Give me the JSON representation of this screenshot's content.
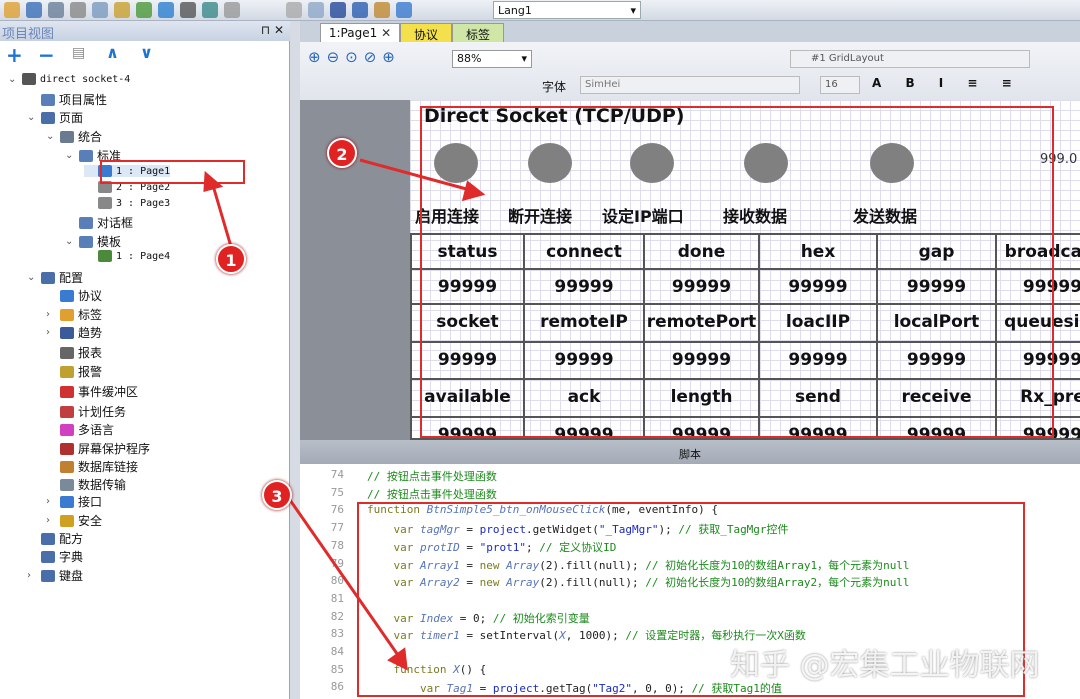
{
  "toolbar": {
    "language": "Lang1"
  },
  "project_view": {
    "title": "项目视图",
    "tree": [
      {
        "label": "direct socket-4",
        "level": 0,
        "mono": true
      },
      {
        "label": "项目属性",
        "level": 1
      },
      {
        "label": "页面",
        "level": 1
      },
      {
        "label": "统合",
        "level": 2
      },
      {
        "label": "标准",
        "level": 3
      },
      {
        "label": "1 : Page1",
        "level": 4,
        "mono": true,
        "selected": true
      },
      {
        "label": "2 : Page2",
        "level": 4,
        "mono": true
      },
      {
        "label": "3 : Page3",
        "level": 4,
        "mono": true
      },
      {
        "label": "对话框",
        "level": 3
      },
      {
        "label": "模板",
        "level": 3
      },
      {
        "label": "1 : Page4",
        "level": 4,
        "mono": true
      },
      {
        "label": "配置",
        "level": 1
      },
      {
        "label": "协议",
        "level": 2
      },
      {
        "label": "标签",
        "level": 2
      },
      {
        "label": "趋势",
        "level": 2
      },
      {
        "label": "报表",
        "level": 2
      },
      {
        "label": "报警",
        "level": 2
      },
      {
        "label": "事件缓冲区",
        "level": 2
      },
      {
        "label": "计划任务",
        "level": 2
      },
      {
        "label": "多语言",
        "level": 2
      },
      {
        "label": "屏幕保护程序",
        "level": 2
      },
      {
        "label": "数据库链接",
        "level": 2
      },
      {
        "label": "数据传输",
        "level": 2
      },
      {
        "label": "接口",
        "level": 2
      },
      {
        "label": "安全",
        "level": 2
      },
      {
        "label": "配方",
        "level": 1
      },
      {
        "label": "字典",
        "level": 1
      },
      {
        "label": "键盘",
        "level": 1
      }
    ]
  },
  "tabs": [
    {
      "label": "1:Page1"
    },
    {
      "label": "协议"
    },
    {
      "label": "标签"
    }
  ],
  "editor_toolbar": {
    "zoom": "88%",
    "layout": "#1 GridLayout",
    "font_label": "字体",
    "font": "SimHei",
    "font_size": "16"
  },
  "page": {
    "title": "Direct Socket (TCP/UDP)",
    "buttons": [
      "启用连接",
      "断开连接",
      "设定IP端口",
      "接收数据",
      "发送数据"
    ],
    "side_value": "999.0",
    "table": [
      [
        "status",
        "connect",
        "done",
        "hex",
        "gap",
        "broadcast"
      ],
      [
        "99999",
        "99999",
        "99999",
        "99999",
        "99999",
        "99999"
      ],
      [
        "socket",
        "remoteIP",
        "remotePort",
        "loacIIP",
        "localPort",
        "queuesize"
      ],
      [
        "99999",
        "99999",
        "99999",
        "99999",
        "99999",
        "99999"
      ],
      [
        "available",
        "ack",
        "length",
        "send",
        "receive",
        "Rx_pre"
      ],
      [
        "99999",
        "99999",
        "99999",
        "99999",
        "99999",
        "99999"
      ]
    ]
  },
  "script": {
    "title": "脚本",
    "lines": [
      {
        "n": "74",
        "html": "<span class='cm'>// 按钮点击事件处理函数</span>"
      },
      {
        "n": "75",
        "html": "<span class='cm'>// 按钮点击事件处理函数</span>"
      },
      {
        "n": "76",
        "html": "<span class='kw'>function</span> <span class='it'>BtnSimple5_btn_onMouseClick</span>(me, eventInfo) {"
      },
      {
        "n": "77",
        "html": "    <span class='kw'>var</span> <span class='it'>tagMgr</span> = <span class='st'>project</span>.getWidget(<span class='st'>\"_TagMgr\"</span>); <span class='cm'>// 获取_TagMgr控件</span>"
      },
      {
        "n": "78",
        "html": "    <span class='kw'>var</span> <span class='it'>protID</span> = <span class='st'>\"prot1\"</span>; <span class='cm'>// 定义协议ID</span>"
      },
      {
        "n": "79",
        "html": "    <span class='kw'>var</span> <span class='it'>Array1</span> = <span class='kw'>new</span> <span class='it'>Array</span>(2).fill(null); <span class='cm'>// 初始化长度为10的数组Array1，每个元素为null</span>"
      },
      {
        "n": "80",
        "html": "    <span class='kw'>var</span> <span class='it'>Array2</span> = <span class='kw'>new</span> <span class='it'>Array</span>(2).fill(null); <span class='cm'>// 初始化长度为10的数组Array2，每个元素为null</span>"
      },
      {
        "n": "81",
        "html": ""
      },
      {
        "n": "82",
        "html": "    <span class='kw'>var</span> <span class='it'>Index</span> = 0; <span class='cm'>// 初始化索引变量</span>"
      },
      {
        "n": "83",
        "html": "    <span class='kw'>var</span> <span class='it'>timer1</span> = setInterval(<span class='it'>X</span>, 1000); <span class='cm'>// 设置定时器，每秒执行一次X函数</span>"
      },
      {
        "n": "84",
        "html": ""
      },
      {
        "n": "85",
        "html": "    <span class='kw'>function</span> <span class='it'>X</span>() {"
      },
      {
        "n": "86",
        "html": "        <span class='kw'>var</span> <span class='it'>Tag1</span> = <span class='st'>project</span>.getTag(<span class='st'>\"Tag2\"</span>, 0, 0); <span class='cm'>// 获取Tag1的值</span>"
      }
    ]
  },
  "annotations": [
    "1",
    "2",
    "3"
  ],
  "watermark": "知乎 @宏集工业物联网",
  "colors": {
    "annotation": "#e02b2b",
    "accent": "#1f74d0"
  }
}
